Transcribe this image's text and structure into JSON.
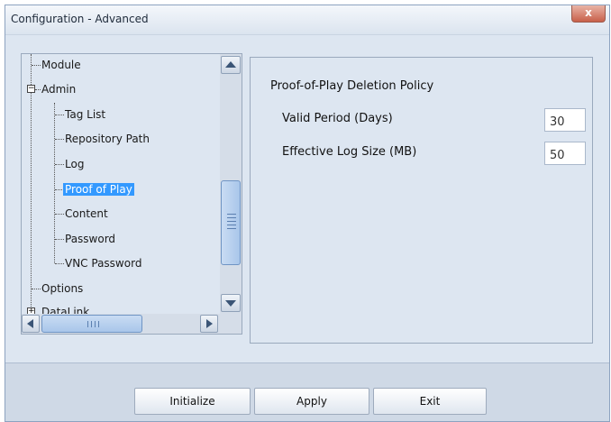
{
  "window": {
    "title": "Configuration - Advanced",
    "close_label": "x"
  },
  "tree": {
    "items": [
      {
        "label": "Module"
      },
      {
        "label": "Admin",
        "expander": "−"
      },
      {
        "label": "Tag List"
      },
      {
        "label": "Repository Path"
      },
      {
        "label": "Log"
      },
      {
        "label": "Proof of Play",
        "selected": true
      },
      {
        "label": "Content"
      },
      {
        "label": "Password"
      },
      {
        "label": "VNC Password"
      },
      {
        "label": "Options"
      },
      {
        "label": "DataLink",
        "expander": "+"
      }
    ]
  },
  "settings": {
    "section_title": "Proof-of-Play Deletion Policy",
    "fields": [
      {
        "label": "Valid Period (Days)",
        "value": "30"
      },
      {
        "label": "Effective Log Size (MB)",
        "value": "50"
      }
    ]
  },
  "buttons": {
    "initialize": "Initialize",
    "apply": "Apply",
    "exit": "Exit"
  },
  "colors": {
    "selection": "#3399ff",
    "window_bg": "#dde6f1",
    "footer_bg": "#cfd9e6"
  }
}
